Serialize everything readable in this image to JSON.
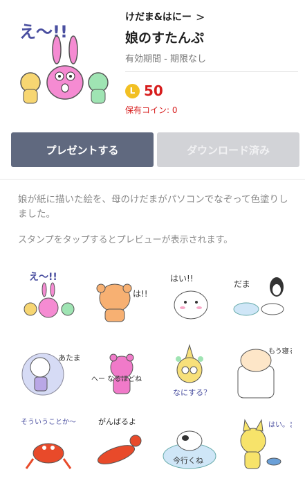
{
  "product": {
    "creator": "けだま&はにー",
    "creator_chevron": ">",
    "title": "娘のすたんぷ",
    "validity": "有効期間 - 期限なし",
    "coin_symbol": "L",
    "price": "50",
    "owned_coins": "保有コイン: 0"
  },
  "actions": {
    "gift_label": "プレゼントする",
    "download_label": "ダウンロード済み"
  },
  "description": "娘が紙に描いた絵を、母のけだまがパソコンでなぞって色塗りしました。",
  "preview_hint": "スタンプをタップするとプレビューが表示されます。",
  "stickers": [
    {
      "text": "え〜!!"
    },
    {
      "text": "は!!"
    },
    {
      "text": "はい!!"
    },
    {
      "text": "だま"
    },
    {
      "text": "あたまが…"
    },
    {
      "text": "へー なるほどね"
    },
    {
      "text": "なにする？"
    },
    {
      "text": "もう寝る…"
    },
    {
      "text": "そういうことか〜"
    },
    {
      "text": "がんばるよ"
    },
    {
      "text": "今行くね"
    },
    {
      "text": "はい。まかせて"
    }
  ],
  "colors": {
    "accent_red": "#d71d1d",
    "gift_button": "#60697f",
    "disabled_button": "#d2d3d7",
    "coin": "#f2c023"
  }
}
